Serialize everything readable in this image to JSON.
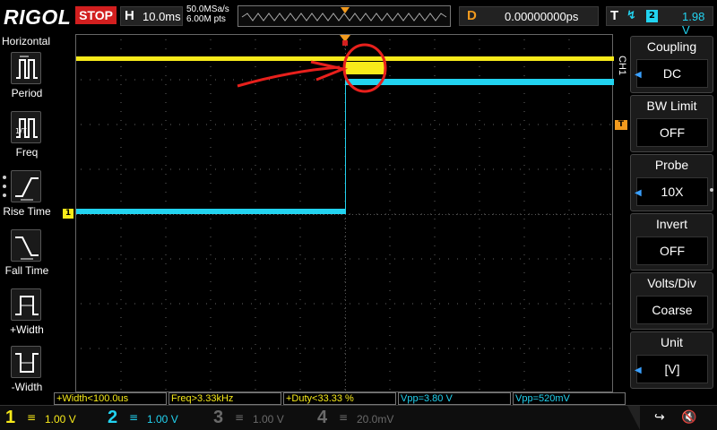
{
  "topbar": {
    "logo": "RIGOL",
    "run_status": "STOP",
    "timebase_letter": "H",
    "timebase_value": "10.0ms",
    "sample_rate": "50.0MSa/s",
    "memory_depth": "6.00M pts",
    "delay_letter": "D",
    "delay_value": "0.00000000ps",
    "trigger_letter": "T",
    "trigger_edge": "↯",
    "trigger_source": "2",
    "trigger_level": "1.98 V",
    "colors": {
      "status_bg": "#d21f1f",
      "delay_accent": "#f29a1e",
      "trigger_accent": "#22d3f0"
    }
  },
  "left_panel": {
    "title": "Horizontal",
    "items": [
      {
        "label": "Period",
        "icon": "period-icon"
      },
      {
        "label": "Freq",
        "icon": "freq-icon"
      },
      {
        "label": "Rise Time",
        "icon": "rise-time-icon"
      },
      {
        "label": "Fall Time",
        "icon": "fall-time-icon"
      },
      {
        "label": "+Width",
        "icon": "pos-width-icon"
      },
      {
        "label": "-Width",
        "icon": "neg-width-icon"
      }
    ]
  },
  "screen": {
    "ch1_marker": "1",
    "trigger_marker": "T",
    "colors": {
      "ch1": "#f7ea1a",
      "ch2": "#22d3f0",
      "annotation": "#e8201c"
    }
  },
  "right_menu": {
    "channel_label": "CH1",
    "items": [
      {
        "title": "Coupling",
        "value": "DC"
      },
      {
        "title": "BW Limit",
        "value": "OFF"
      },
      {
        "title": "Probe",
        "value": "10X"
      },
      {
        "title": "Invert",
        "value": "OFF"
      },
      {
        "title": "Volts/Div",
        "value": "Coarse"
      },
      {
        "title": "Unit",
        "value": "[V]"
      }
    ]
  },
  "measurements": [
    {
      "text": "+Width<100.0us",
      "color": "#f7ea1a"
    },
    {
      "text": "Freq>3.33kHz",
      "color": "#f7ea1a"
    },
    {
      "text": "+Duty<33.33 %",
      "color": "#f7ea1a"
    },
    {
      "text": "Vpp=3.80 V",
      "color": "#22d3f0"
    },
    {
      "text": "Vpp=520mV",
      "color": "#22d3f0"
    }
  ],
  "bottom_bar": {
    "channels": [
      {
        "num": "1",
        "scale": "1.00 V",
        "color": "#f7ea1a"
      },
      {
        "num": "2",
        "scale": "1.00 V",
        "color": "#22d3f0"
      },
      {
        "num": "3",
        "scale": "1.00 V",
        "color": "#6a6a6a"
      },
      {
        "num": "4",
        "scale": "20.0mV",
        "color": "#6a6a6a"
      }
    ],
    "usb_icon": "usb-icon",
    "sound_icon": "sound-icon"
  }
}
